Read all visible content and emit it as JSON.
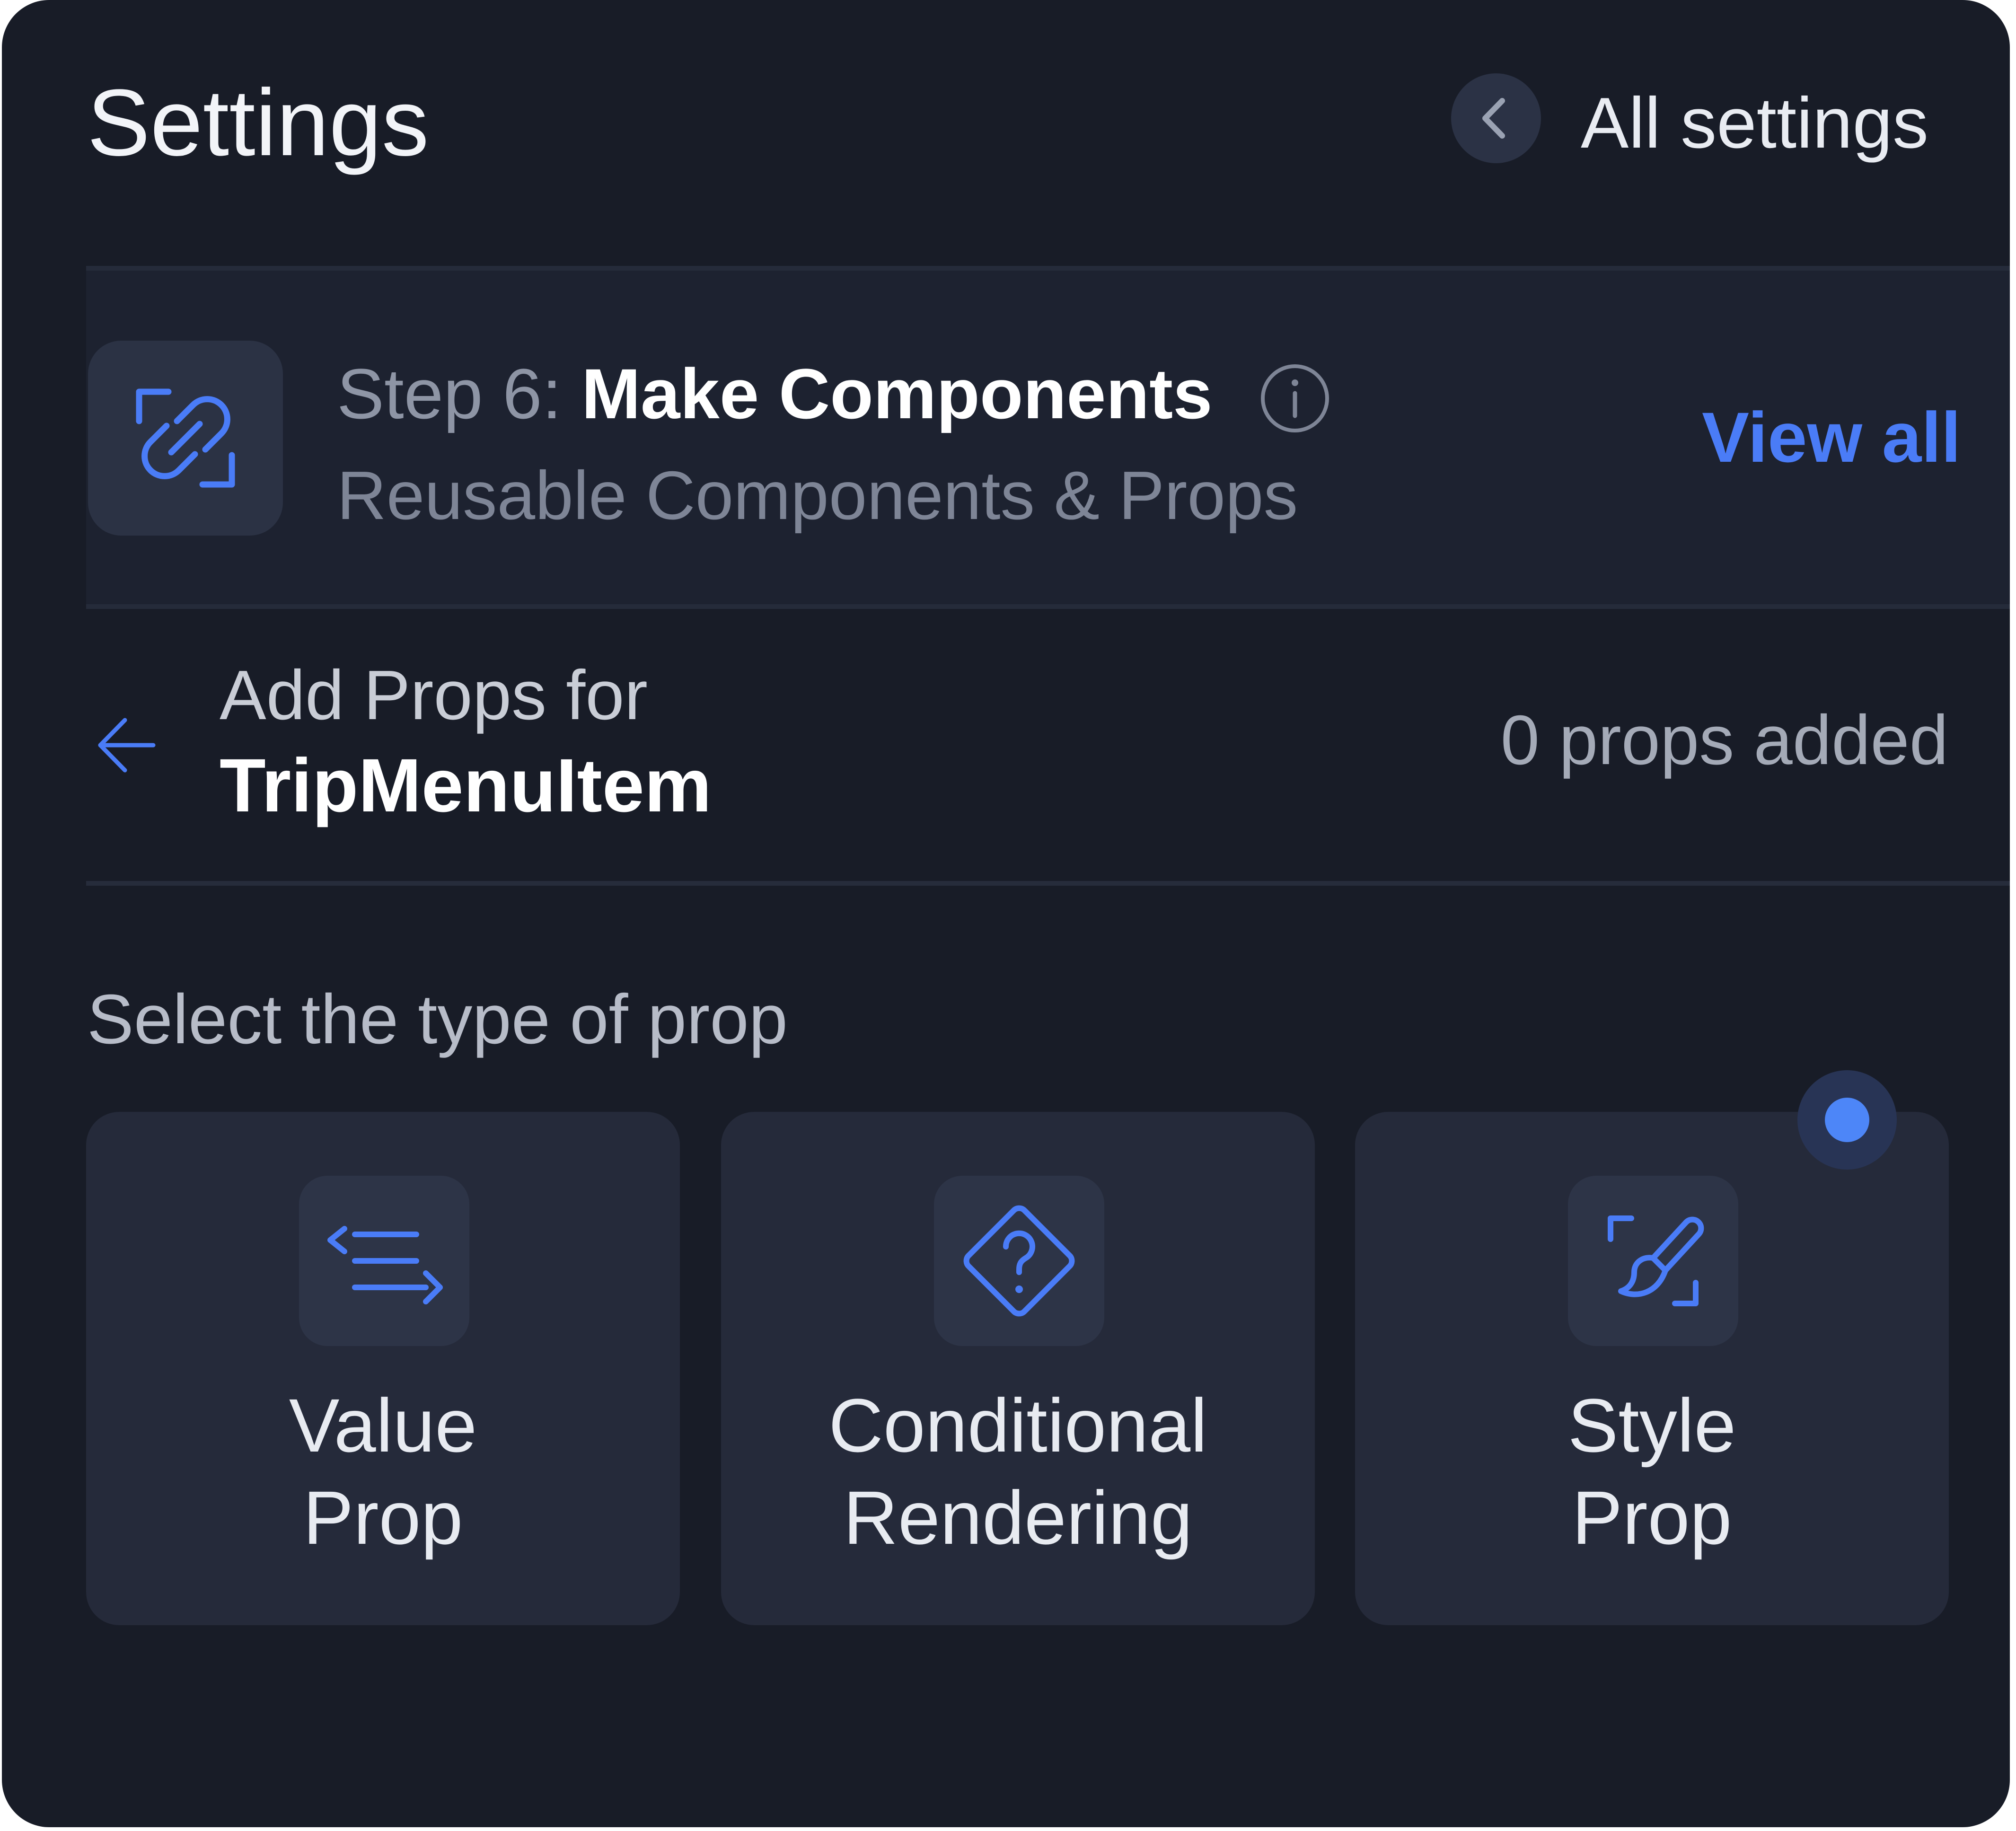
{
  "header": {
    "title": "Settings",
    "back_label": "All settings"
  },
  "step": {
    "prefix": "Step 6:",
    "name": "Make Components",
    "subtitle": "Reusable Components & Props",
    "view_all": "View all"
  },
  "props": {
    "label": "Add Props for",
    "component": "TripMenuItem",
    "count": "0 props added"
  },
  "prop_types": {
    "heading": "Select the type of prop",
    "cards": [
      {
        "line1": "Value",
        "line2": "Prop",
        "icon": "value-prop-icon"
      },
      {
        "line1": "Conditional",
        "line2": "Rendering",
        "icon": "conditional-icon"
      },
      {
        "line1": "Style",
        "line2": "Prop",
        "icon": "style-brush-icon"
      }
    ]
  },
  "colors": {
    "background": "#181c27",
    "card": "#252a3a",
    "accent": "#4a7cf7"
  }
}
